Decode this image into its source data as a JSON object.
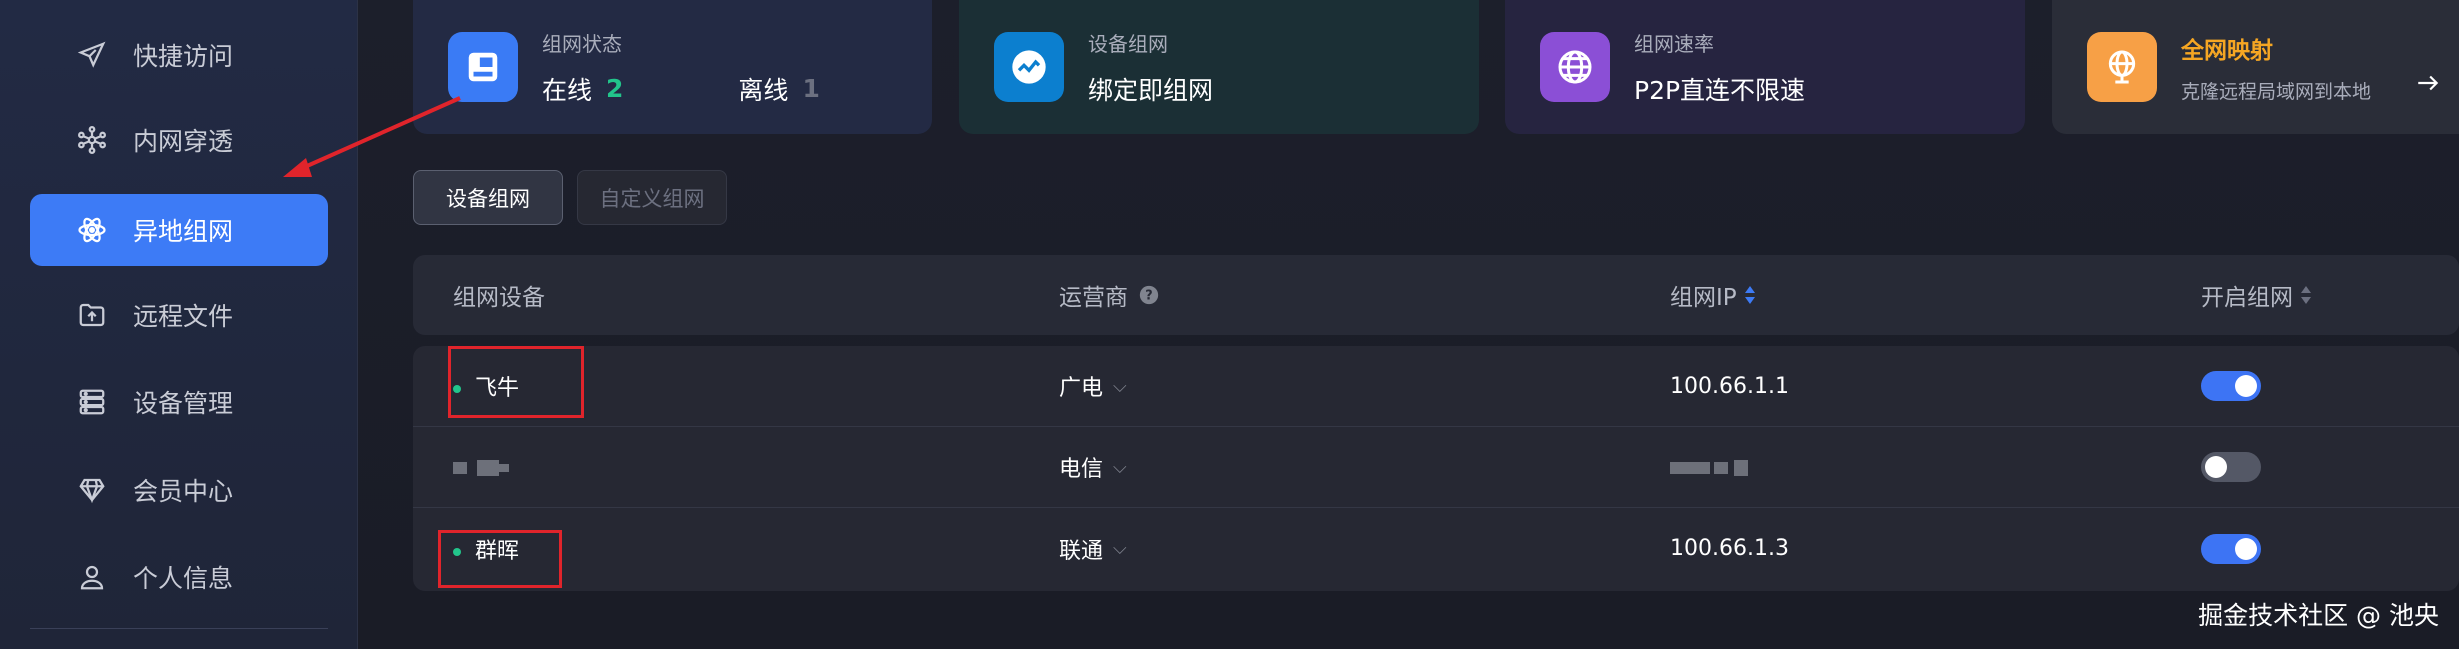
{
  "sidebar": {
    "items": [
      {
        "label": "快捷访问",
        "icon": "send-icon"
      },
      {
        "label": "内网穿透",
        "icon": "network-nodes-icon"
      },
      {
        "label": "异地组网",
        "icon": "atom-icon",
        "active": true
      },
      {
        "label": "远程文件",
        "icon": "folder-upload-icon"
      },
      {
        "label": "设备管理",
        "icon": "server-icon"
      },
      {
        "label": "会员中心",
        "icon": "diamond-icon"
      },
      {
        "label": "个人信息",
        "icon": "user-icon"
      }
    ]
  },
  "cards": {
    "status": {
      "label": "组网状态",
      "online_label": "在线",
      "online_count": "2",
      "offline_label": "离线",
      "offline_count": "1",
      "icon": "layout-icon"
    },
    "device": {
      "label": "设备组网",
      "value": "绑定即组网",
      "icon": "pulse-icon"
    },
    "rate": {
      "label": "组网速率",
      "value": "P2P直连不限速",
      "icon": "globe-icon"
    },
    "mapping": {
      "label": "全网映射",
      "value": "克隆远程局域网到本地",
      "icon": "globe-monitor-icon"
    }
  },
  "tabs": {
    "active": "设备组网",
    "inactive": "自定义组网"
  },
  "table": {
    "headers": {
      "device": "组网设备",
      "carrier": "运营商",
      "ip": "组网IP",
      "enable": "开启组网"
    },
    "rows": [
      {
        "device": "飞牛",
        "carrier": "广电",
        "ip": "100.66.1.1",
        "online": true,
        "enabled": true
      },
      {
        "device": "",
        "carrier": "电信",
        "ip": "",
        "online": false,
        "enabled": false
      },
      {
        "device": "群晖",
        "carrier": "联通",
        "ip": "100.66.1.3",
        "online": true,
        "enabled": true
      }
    ]
  },
  "watermark": "掘金技术社区 @ 池央",
  "colors": {
    "accent": "#3d7bf6",
    "online": "#22c58b",
    "annotation": "#e0242b",
    "mapping_title": "#f5a623"
  }
}
